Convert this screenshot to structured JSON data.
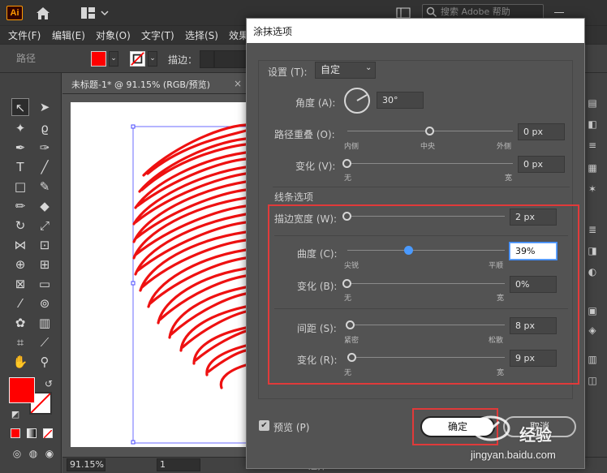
{
  "app": {
    "logo_text": "Ai",
    "search_placeholder": "搜索 Adobe 帮助"
  },
  "menu": [
    "文件(F)",
    "编辑(E)",
    "对象(O)",
    "文字(T)",
    "选择(S)",
    "效果"
  ],
  "control_bar": {
    "path_label": "路径",
    "stroke_label": "描边："
  },
  "document": {
    "tab_title": "未标题-1* @ 91.15% (RGB/预览)",
    "close_glyph": "×"
  },
  "status": {
    "zoom": "91.15%",
    "page": "1",
    "select_label": "选择"
  },
  "dialog": {
    "title": "涂抹选项",
    "settings_label": "设置 (T):",
    "preset_value": "自定",
    "angle_label": "角度 (A):",
    "angle_value": "30°",
    "path_overlap_label": "路径重叠 (O):",
    "path_overlap_value": "0 px",
    "path_overlap_min": "内侧",
    "path_overlap_mid": "中央",
    "path_overlap_max": "外侧",
    "variation1_label": "变化 (V):",
    "variation1_value": "0 px",
    "variation1_min": "无",
    "variation1_max": "宽",
    "line_options_label": "线条选项",
    "stroke_width_label": "描边宽度 (W):",
    "stroke_width_value": "2 px",
    "curviness_label": "曲度 (C):",
    "curviness_value": "39%",
    "curviness_min": "尖锐",
    "curviness_max": "平顺",
    "variation2_label": "变化 (B):",
    "variation2_value": "0%",
    "variation2_min": "无",
    "variation2_max": "宽",
    "spacing_label": "间距 (S):",
    "spacing_value": "8 px",
    "spacing_min": "紧密",
    "spacing_max": "松散",
    "variation3_label": "变化 (R):",
    "variation3_value": "9 px",
    "variation3_min": "无",
    "variation3_max": "宽",
    "preview_label": "预览 (P)",
    "ok_label": "确定",
    "cancel_label": "取消"
  },
  "slider_levels": {
    "path_overlap": 0.5,
    "variation1": 0.0,
    "stroke_width": 0.0,
    "curviness": 0.39,
    "variation2": 0.0,
    "spacing": 0.02,
    "variation3": 0.03
  },
  "watermark": {
    "line1": "经验",
    "line2": "jingyan.baidu.com"
  },
  "colors": {
    "fill": "#ff0000",
    "accent": "#4a9aff",
    "highlight": "#e03a3a"
  }
}
